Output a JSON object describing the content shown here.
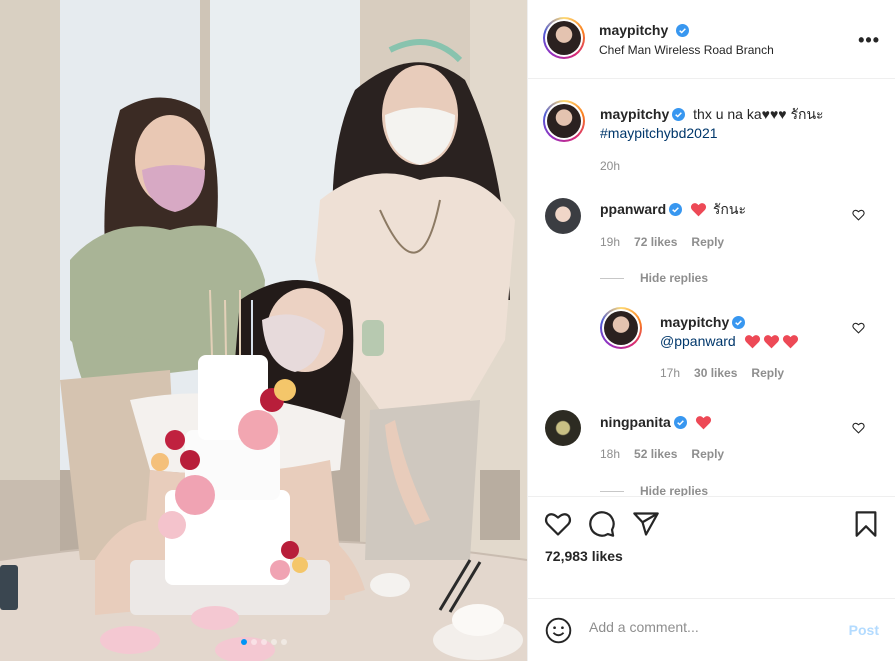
{
  "post": {
    "username": "maypitchy",
    "location": "Chef Man Wireless Road Branch",
    "more_label": "•••"
  },
  "caption": {
    "username": "maypitchy",
    "text": "thx u na ka♥♥♥ รักนะ",
    "hashtag": "#maypitchybd2021",
    "time": "20h"
  },
  "comments": [
    {
      "username": "ppanward",
      "text": "รักนะ",
      "time": "19h",
      "likes": "72 likes",
      "reply": "Reply"
    },
    {
      "username": "maypitchy",
      "mention": "@ppanward",
      "time": "17h",
      "likes": "30 likes",
      "reply": "Reply"
    },
    {
      "username": "ningpanita",
      "time": "18h",
      "likes": "52 likes",
      "reply": "Reply"
    }
  ],
  "hide_replies": "Hide replies",
  "hide_replies_2": "Hide replies",
  "likes_count": "72,983 likes",
  "add_comment": {
    "placeholder": "Add a comment...",
    "post_label": "Post"
  },
  "carousel": {
    "count": 5,
    "active_index": 0
  },
  "icons": {
    "like": "heart-icon",
    "comment": "comment-icon",
    "share": "paper-plane-icon",
    "save": "bookmark-icon",
    "emoji": "emoji-icon",
    "verified": "verified-badge-icon"
  },
  "colors": {
    "accent": "#0095f6",
    "heart_red": "#ed4956",
    "post_disabled": "#b3dbff"
  }
}
